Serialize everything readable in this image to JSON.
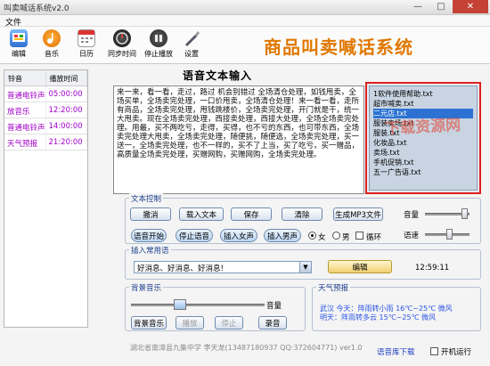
{
  "window": {
    "title": "叫卖喊话系统v2.0"
  },
  "menu": {
    "file": "文件"
  },
  "toolbar": {
    "items": [
      {
        "label": "编辑",
        "icon": "edit-icon"
      },
      {
        "label": "音乐",
        "icon": "music-icon"
      },
      {
        "label": "日历",
        "icon": "calendar-icon"
      },
      {
        "label": "同步时间",
        "icon": "sync-time-icon"
      },
      {
        "label": "停止播放",
        "icon": "stop-play-icon"
      },
      {
        "label": "设置",
        "icon": "settings-icon"
      }
    ]
  },
  "app_title": "商品叫卖喊话系统",
  "ringtone_table": {
    "headers": [
      "铃音",
      "播放时间"
    ],
    "rows": [
      {
        "name": "普通电铃声",
        "time": "05:00:00"
      },
      {
        "name": "放音乐",
        "time": "12:20:00"
      },
      {
        "name": "普通电铃声",
        "time": "14:00:00"
      },
      {
        "name": "天气预报",
        "time": "21:20:00"
      }
    ]
  },
  "voice_text": {
    "title": "语音文本输入",
    "content": "来一来，看一看，走过，路过 机会别错过 全场清仓处理，如钱甩卖，全场买单，全场卖完处理，一口价甩卖，全场清仓处理！来一看一看，走所有商品，全场卖完处理，甩钱跳楼价，全场卖完处理，开门就是干，统一大甩卖。现在全场卖完处理，西接卖处理，西接大处理，全场全场卖完处理。用最，买不两吃亏，走得，买得，也不亏的东西，也可带东西，全场卖完处理大甩卖，全场卖完处理，随便挑，随便选，全场卖完处理，买一送一，全场卖完处理，也不一样的，买不了上当，买了吃亏，买一赠品，高质量全场卖完处理，买赠网购，买赠网购，全场卖完处理。"
  },
  "file_list": {
    "items": [
      "1软件使用帮助.txt",
      "超市喊卖.txt",
      "二元店.txt",
      "服装卖场.txt",
      "服装.txt",
      "化妆品.txt",
      "卖场.txt",
      "手机促销.txt",
      "五一广告语.txt"
    ],
    "selected_index": 2,
    "watermark": "下载资源网"
  },
  "text_control": {
    "title": "文本控制",
    "buttons": {
      "cancel": "撤消",
      "load": "载入文本",
      "save": "保存",
      "clear": "清除",
      "gen_mp3": "生成MP3文件"
    },
    "voice_buttons": {
      "start": "语音开始",
      "stop": "停止语音",
      "insert_female": "插入女声",
      "insert_male": "插入男声"
    },
    "gender": {
      "female": "女",
      "male": "男",
      "selected": "female"
    },
    "loop_label": "循环",
    "loop_checked": false,
    "volume_label": "音量",
    "volume_level": 0.95,
    "speed_label": "语速",
    "speed_level": 0.55
  },
  "phrases": {
    "title": "插入常用语",
    "value": "好消息、好消息、好消息!",
    "edit_button": "编辑"
  },
  "clock": "12:59:11",
  "background_music": {
    "title": "背景音乐",
    "volume_label": "音量",
    "volume_level": 0.35,
    "buttons": {
      "bgm": "背景音乐",
      "play": "播放",
      "stop": "停止",
      "record": "录音"
    }
  },
  "weather": {
    "title": "天气预报",
    "lines": [
      "武汉  今天：阵雨转小雨 16℃~25℃ 微风",
      "明天：阵雨转多云 15℃~25℃ 微风"
    ]
  },
  "footer": {
    "credit": "湖北省南漳县九集中学  李天龙(13487180937 QQ:372604771)   ver1.0",
    "download_link": "语音库下载",
    "autostart_label": "开机运行",
    "autostart_checked": false
  },
  "colors": {
    "accent_orange": "#e07800",
    "list_purple": "#a000c8",
    "highlight_red": "#e02020",
    "link_blue": "#1c3ec0"
  }
}
